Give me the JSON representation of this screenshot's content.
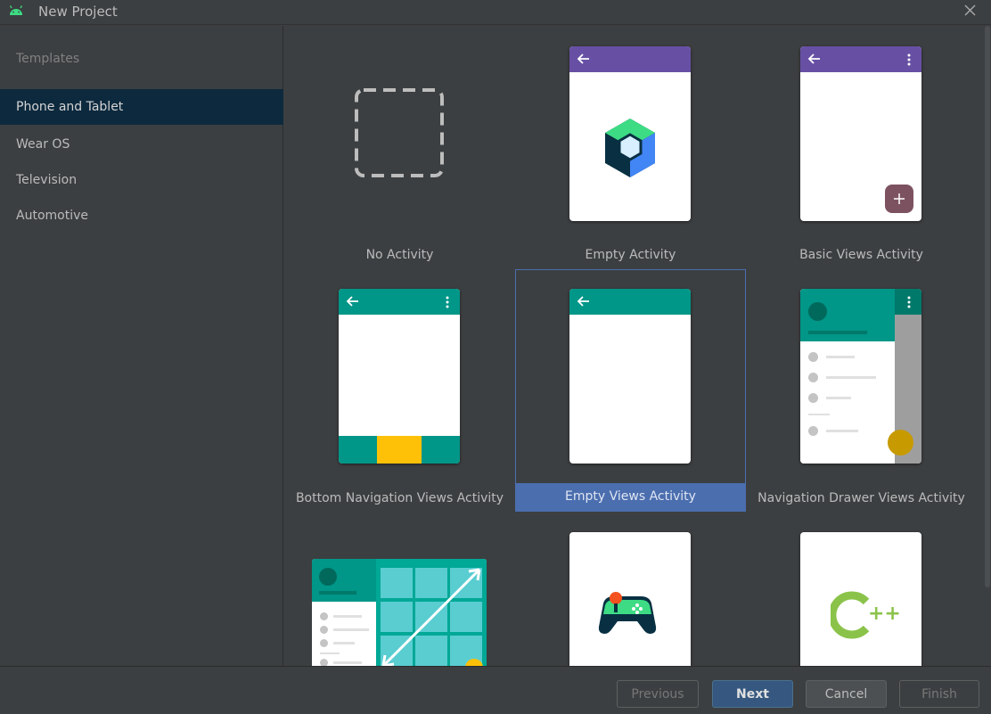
{
  "window": {
    "title": "New Project"
  },
  "sidebar": {
    "section_label": "Templates",
    "items": [
      {
        "label": "Phone and Tablet",
        "selected": true
      },
      {
        "label": "Wear OS",
        "selected": false
      },
      {
        "label": "Television",
        "selected": false
      },
      {
        "label": "Automotive",
        "selected": false
      }
    ]
  },
  "templates": [
    {
      "label": "No Activity",
      "icon": "dashed-square-icon"
    },
    {
      "label": "Empty Activity",
      "icon": "compose-hexagon-icon"
    },
    {
      "label": "Basic Views Activity",
      "icon": "fab-plus-icon"
    },
    {
      "label": "Bottom Navigation Views Activity",
      "icon": "bottom-nav-icon"
    },
    {
      "label": "Empty Views Activity",
      "icon": "empty-views-icon",
      "selected": true
    },
    {
      "label": "Navigation Drawer Views Activity",
      "icon": "nav-drawer-icon"
    },
    {
      "label": "",
      "icon": "responsive-grid-icon"
    },
    {
      "label": "",
      "icon": "gamepad-icon"
    },
    {
      "label": "",
      "icon": "cpp-icon",
      "cpp_text": "++"
    }
  ],
  "footer": {
    "previous": "Previous",
    "next": "Next",
    "cancel": "Cancel",
    "finish": "Finish"
  },
  "colors": {
    "background": "#3c3f41",
    "sidebar_selected": "#0d293e",
    "tile_selected": "#4b6eaf",
    "purple_appbar": "#6750a4",
    "teal_appbar": "#009688",
    "fab_maroon": "#7d5260",
    "bottom_nav_yellow": "#ffc107",
    "android_green": "#3ddc84"
  }
}
